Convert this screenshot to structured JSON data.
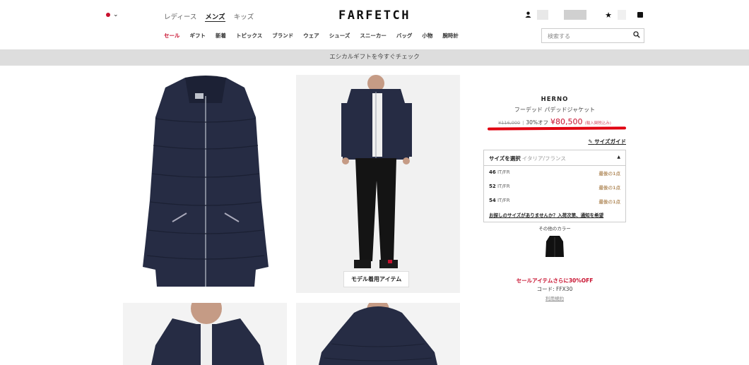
{
  "header": {
    "logo": "FARFETCH",
    "gender_tabs": [
      "レディース",
      "メンズ",
      "キッズ"
    ],
    "active_gender": "メンズ",
    "nav": [
      "セール",
      "ギフト",
      "新着",
      "トピックス",
      "ブランド",
      "ウェア",
      "シューズ",
      "スニーカー",
      "バッグ",
      "小物",
      "腕時計"
    ],
    "search_placeholder": "検索する"
  },
  "banner": "エシカルギフトを今すぐチェック",
  "gallery": {
    "model_tag": "モデル着用アイテム"
  },
  "product": {
    "brand": "HERNO",
    "name": "フーデッド パデッドジャケット",
    "old_price": "¥116,000",
    "separator": "|",
    "discount": "30%オフ",
    "price": "¥80,500",
    "tax_note": "(輸入関税込み)",
    "size_guide": "サイズガイド",
    "size_select_label": "サイズを選択",
    "size_region": "イタリア/フランス",
    "sizes": [
      {
        "size": "46",
        "unit": "IT/FR",
        "stock": "最後の1点"
      },
      {
        "size": "52",
        "unit": "IT/FR",
        "stock": "最後の1点"
      },
      {
        "size": "54",
        "unit": "IT/FR",
        "stock": "最後の1点"
      }
    ],
    "notify_link": "お探しのサイズがありませんか？入荷次第、通知を希望",
    "other_colors_label": "その他のカラー",
    "promo_line": "セールアイテムさらに30%OFF",
    "promo_code": "コード: FFX30",
    "terms_link": "利用規約"
  },
  "colors": {
    "accent_red": "#c8102e",
    "jacket_navy": "#262c44",
    "banner_bg": "#dddddd",
    "stock_gold": "#b8956a"
  }
}
